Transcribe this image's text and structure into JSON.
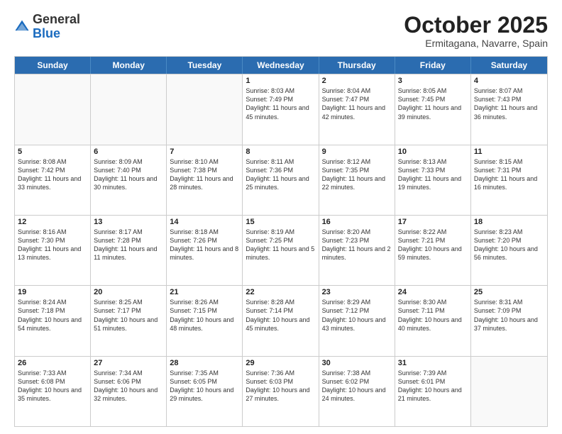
{
  "header": {
    "logo_general": "General",
    "logo_blue": "Blue",
    "month": "October 2025",
    "location": "Ermitagana, Navarre, Spain"
  },
  "weekdays": [
    "Sunday",
    "Monday",
    "Tuesday",
    "Wednesday",
    "Thursday",
    "Friday",
    "Saturday"
  ],
  "rows": [
    [
      {
        "day": "",
        "info": ""
      },
      {
        "day": "",
        "info": ""
      },
      {
        "day": "",
        "info": ""
      },
      {
        "day": "1",
        "info": "Sunrise: 8:03 AM\nSunset: 7:49 PM\nDaylight: 11 hours and 45 minutes."
      },
      {
        "day": "2",
        "info": "Sunrise: 8:04 AM\nSunset: 7:47 PM\nDaylight: 11 hours and 42 minutes."
      },
      {
        "day": "3",
        "info": "Sunrise: 8:05 AM\nSunset: 7:45 PM\nDaylight: 11 hours and 39 minutes."
      },
      {
        "day": "4",
        "info": "Sunrise: 8:07 AM\nSunset: 7:43 PM\nDaylight: 11 hours and 36 minutes."
      }
    ],
    [
      {
        "day": "5",
        "info": "Sunrise: 8:08 AM\nSunset: 7:42 PM\nDaylight: 11 hours and 33 minutes."
      },
      {
        "day": "6",
        "info": "Sunrise: 8:09 AM\nSunset: 7:40 PM\nDaylight: 11 hours and 30 minutes."
      },
      {
        "day": "7",
        "info": "Sunrise: 8:10 AM\nSunset: 7:38 PM\nDaylight: 11 hours and 28 minutes."
      },
      {
        "day": "8",
        "info": "Sunrise: 8:11 AM\nSunset: 7:36 PM\nDaylight: 11 hours and 25 minutes."
      },
      {
        "day": "9",
        "info": "Sunrise: 8:12 AM\nSunset: 7:35 PM\nDaylight: 11 hours and 22 minutes."
      },
      {
        "day": "10",
        "info": "Sunrise: 8:13 AM\nSunset: 7:33 PM\nDaylight: 11 hours and 19 minutes."
      },
      {
        "day": "11",
        "info": "Sunrise: 8:15 AM\nSunset: 7:31 PM\nDaylight: 11 hours and 16 minutes."
      }
    ],
    [
      {
        "day": "12",
        "info": "Sunrise: 8:16 AM\nSunset: 7:30 PM\nDaylight: 11 hours and 13 minutes."
      },
      {
        "day": "13",
        "info": "Sunrise: 8:17 AM\nSunset: 7:28 PM\nDaylight: 11 hours and 11 minutes."
      },
      {
        "day": "14",
        "info": "Sunrise: 8:18 AM\nSunset: 7:26 PM\nDaylight: 11 hours and 8 minutes."
      },
      {
        "day": "15",
        "info": "Sunrise: 8:19 AM\nSunset: 7:25 PM\nDaylight: 11 hours and 5 minutes."
      },
      {
        "day": "16",
        "info": "Sunrise: 8:20 AM\nSunset: 7:23 PM\nDaylight: 11 hours and 2 minutes."
      },
      {
        "day": "17",
        "info": "Sunrise: 8:22 AM\nSunset: 7:21 PM\nDaylight: 10 hours and 59 minutes."
      },
      {
        "day": "18",
        "info": "Sunrise: 8:23 AM\nSunset: 7:20 PM\nDaylight: 10 hours and 56 minutes."
      }
    ],
    [
      {
        "day": "19",
        "info": "Sunrise: 8:24 AM\nSunset: 7:18 PM\nDaylight: 10 hours and 54 minutes."
      },
      {
        "day": "20",
        "info": "Sunrise: 8:25 AM\nSunset: 7:17 PM\nDaylight: 10 hours and 51 minutes."
      },
      {
        "day": "21",
        "info": "Sunrise: 8:26 AM\nSunset: 7:15 PM\nDaylight: 10 hours and 48 minutes."
      },
      {
        "day": "22",
        "info": "Sunrise: 8:28 AM\nSunset: 7:14 PM\nDaylight: 10 hours and 45 minutes."
      },
      {
        "day": "23",
        "info": "Sunrise: 8:29 AM\nSunset: 7:12 PM\nDaylight: 10 hours and 43 minutes."
      },
      {
        "day": "24",
        "info": "Sunrise: 8:30 AM\nSunset: 7:11 PM\nDaylight: 10 hours and 40 minutes."
      },
      {
        "day": "25",
        "info": "Sunrise: 8:31 AM\nSunset: 7:09 PM\nDaylight: 10 hours and 37 minutes."
      }
    ],
    [
      {
        "day": "26",
        "info": "Sunrise: 7:33 AM\nSunset: 6:08 PM\nDaylight: 10 hours and 35 minutes."
      },
      {
        "day": "27",
        "info": "Sunrise: 7:34 AM\nSunset: 6:06 PM\nDaylight: 10 hours and 32 minutes."
      },
      {
        "day": "28",
        "info": "Sunrise: 7:35 AM\nSunset: 6:05 PM\nDaylight: 10 hours and 29 minutes."
      },
      {
        "day": "29",
        "info": "Sunrise: 7:36 AM\nSunset: 6:03 PM\nDaylight: 10 hours and 27 minutes."
      },
      {
        "day": "30",
        "info": "Sunrise: 7:38 AM\nSunset: 6:02 PM\nDaylight: 10 hours and 24 minutes."
      },
      {
        "day": "31",
        "info": "Sunrise: 7:39 AM\nSunset: 6:01 PM\nDaylight: 10 hours and 21 minutes."
      },
      {
        "day": "",
        "info": ""
      }
    ]
  ]
}
